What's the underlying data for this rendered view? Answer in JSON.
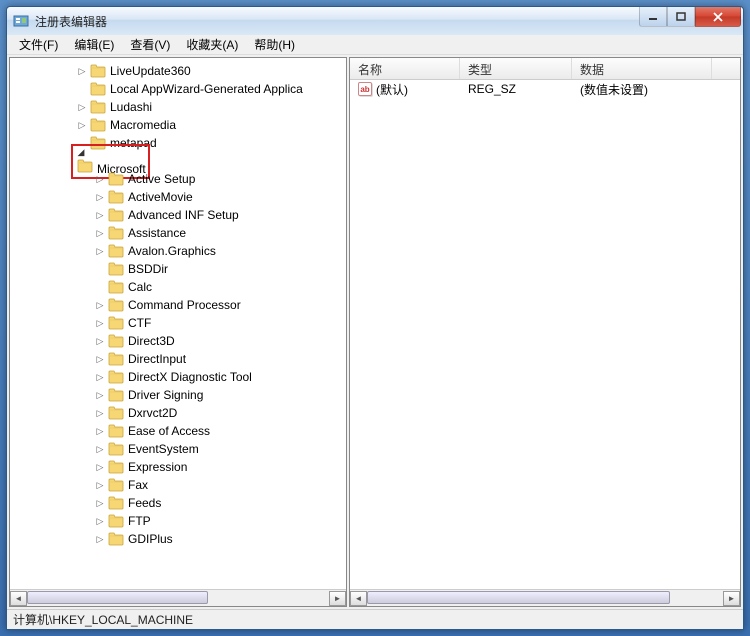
{
  "title": "注册表编辑器",
  "menu": [
    "文件(F)",
    "编辑(E)",
    "查看(V)",
    "收藏夹(A)",
    "帮助(H)"
  ],
  "tree": {
    "items": [
      {
        "indent": 66,
        "exp": "▷",
        "label": "LiveUpdate360"
      },
      {
        "indent": 66,
        "exp": "",
        "label": "Local AppWizard-Generated Applica"
      },
      {
        "indent": 66,
        "exp": "▷",
        "label": "Ludashi"
      },
      {
        "indent": 66,
        "exp": "▷",
        "label": "Macromedia"
      },
      {
        "indent": 66,
        "exp": "",
        "label": "metapad"
      },
      {
        "indent": 66,
        "exp": "◢",
        "label": "Microsoft",
        "highlight": true
      },
      {
        "indent": 84,
        "exp": "▷",
        "label": "Active Setup"
      },
      {
        "indent": 84,
        "exp": "▷",
        "label": "ActiveMovie"
      },
      {
        "indent": 84,
        "exp": "▷",
        "label": "Advanced INF Setup"
      },
      {
        "indent": 84,
        "exp": "▷",
        "label": "Assistance"
      },
      {
        "indent": 84,
        "exp": "▷",
        "label": "Avalon.Graphics"
      },
      {
        "indent": 84,
        "exp": "",
        "label": "BSDDir"
      },
      {
        "indent": 84,
        "exp": "",
        "label": "Calc"
      },
      {
        "indent": 84,
        "exp": "▷",
        "label": "Command Processor"
      },
      {
        "indent": 84,
        "exp": "▷",
        "label": "CTF"
      },
      {
        "indent": 84,
        "exp": "▷",
        "label": "Direct3D"
      },
      {
        "indent": 84,
        "exp": "▷",
        "label": "DirectInput"
      },
      {
        "indent": 84,
        "exp": "▷",
        "label": "DirectX Diagnostic Tool"
      },
      {
        "indent": 84,
        "exp": "▷",
        "label": "Driver Signing"
      },
      {
        "indent": 84,
        "exp": "▷",
        "label": "Dxrvct2D"
      },
      {
        "indent": 84,
        "exp": "▷",
        "label": "Ease of Access"
      },
      {
        "indent": 84,
        "exp": "▷",
        "label": "EventSystem"
      },
      {
        "indent": 84,
        "exp": "▷",
        "label": "Expression"
      },
      {
        "indent": 84,
        "exp": "▷",
        "label": "Fax"
      },
      {
        "indent": 84,
        "exp": "▷",
        "label": "Feeds"
      },
      {
        "indent": 84,
        "exp": "▷",
        "label": "FTP"
      },
      {
        "indent": 84,
        "exp": "▷",
        "label": "GDIPlus"
      }
    ]
  },
  "list": {
    "columns": [
      {
        "label": "名称",
        "width": 110
      },
      {
        "label": "类型",
        "width": 112
      },
      {
        "label": "数据",
        "width": 140
      }
    ],
    "rows": [
      {
        "name": "(默认)",
        "type": "REG_SZ",
        "data": "(数值未设置)"
      }
    ]
  },
  "statusbar": "计算机\\HKEY_LOCAL_MACHINE"
}
